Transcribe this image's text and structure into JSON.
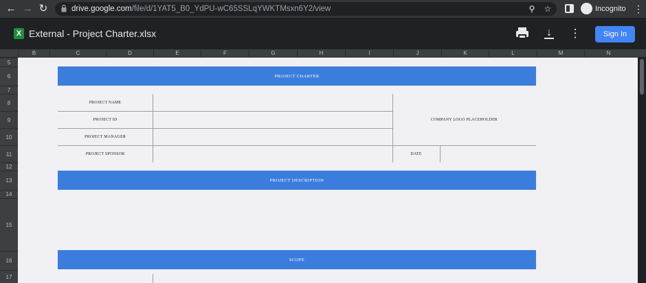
{
  "browser": {
    "url_domain": "drive.google.com",
    "url_path": "/file/d/1YAT5_B0_YdPU-wC65SSLqYWKTMsxn6Y2/view",
    "profile_label": "Incognito",
    "icons": [
      "back-icon",
      "forward-icon",
      "reload-icon",
      "lock-icon",
      "zoom-icon",
      "star-icon",
      "side-panel-icon",
      "incognito-icon",
      "menu-icon"
    ]
  },
  "viewer": {
    "file_title": "External - Project Charter.xlsx",
    "file_icon_letter": "X",
    "sign_in_label": "Sign In",
    "accent_color": "#4285f4"
  },
  "columns": [
    "B",
    "C",
    "D",
    "E",
    "F",
    "G",
    "H",
    "I",
    "J",
    "K",
    "L",
    "M",
    "N"
  ],
  "rows": [
    "5",
    "6",
    "7",
    "8",
    "9",
    "10",
    "11",
    "12",
    "13",
    "14",
    "15",
    "16",
    "17"
  ],
  "sheet": {
    "banner_color": "#3b7ddd",
    "project_charter": "PROJECT CHARTER",
    "project_name": "PROJECT NAME",
    "project_id": "PROJECT ID",
    "project_manager": "PROJECT MANAGER",
    "project_sponsor": "PROJECT SPONSOR",
    "company_logo": "COMPANY LOGO PLACEHOLDER",
    "date": "DATE",
    "project_description": "PROJECT DESCRIPTION",
    "scope": "SCOPE"
  }
}
